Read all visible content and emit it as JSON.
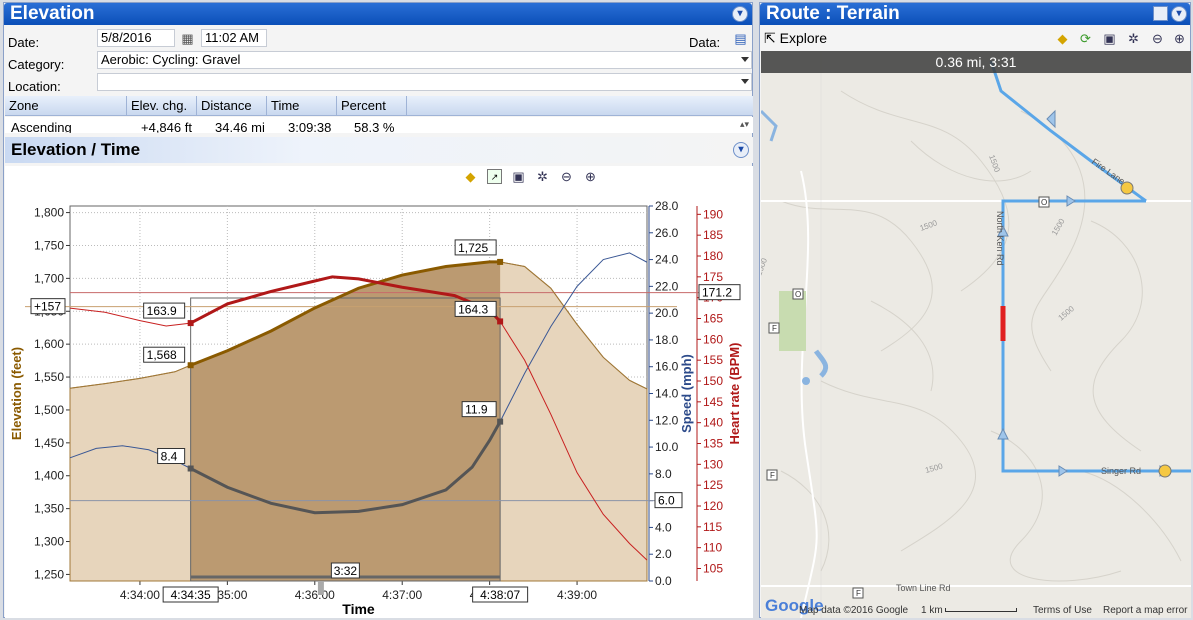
{
  "left_panel": {
    "title": "Elevation",
    "date_label": "Date:",
    "date_value": "5/8/2016",
    "time_value": "11:02 AM",
    "data_label": "Data:",
    "category_label": "Category:",
    "category_value": "Aerobic: Cycling: Gravel",
    "location_label": "Location:",
    "location_value": "",
    "grid": {
      "headers": [
        "Zone",
        "Elev. chg.",
        "Distance",
        "Time",
        "Percent"
      ],
      "row": [
        "Ascending",
        "+4,846 ft",
        "34.46 mi",
        "3:09:38",
        "58.3 %"
      ]
    }
  },
  "chart_panel": {
    "title": "Elevation / Time",
    "icons": [
      "diamond-icon",
      "chart-icon",
      "save-icon",
      "settings-icon",
      "zoom-out-icon",
      "zoom-in-icon"
    ]
  },
  "chart_data": {
    "type": "area",
    "xlabel": "Time",
    "x_ticks": [
      "4:34:00",
      "4:35:00",
      "4:36:00",
      "4:37:00",
      "4:38:00",
      "4:39:00"
    ],
    "elevation_axis": {
      "label": "Elevation (feet)",
      "ticks": [
        "1,800",
        "1,750",
        "1,700",
        "1,650",
        "1,600",
        "1,550",
        "1,500",
        "1,450",
        "1,400",
        "1,350",
        "1,300",
        "1,250"
      ],
      "range": [
        1240,
        1810
      ],
      "color": "#8a5a00"
    },
    "speed_axis": {
      "label": "Speed (mph)",
      "ticks": [
        "28.0",
        "26.0",
        "24.0",
        "22.0",
        "20.0",
        "18.0",
        "16.0",
        "14.0",
        "12.0",
        "10.0",
        "8.0",
        "6.0",
        "4.0",
        "2.0",
        "0.0"
      ],
      "range": [
        0,
        28
      ],
      "color": "#2c4a8a"
    },
    "hr_axis": {
      "label": "Heart rate (BPM)",
      "ticks": [
        "190",
        "185",
        "180",
        "175",
        "170",
        "165",
        "160",
        "155",
        "150",
        "145",
        "140",
        "135",
        "130",
        "125",
        "120",
        "115",
        "110",
        "105"
      ],
      "range": [
        102,
        192
      ],
      "color": "#b01818"
    },
    "x_range_min": [
      33.2,
      39.8
    ],
    "selection": {
      "start": "4:34:35",
      "end": "4:38:07",
      "duration": "3:32",
      "start_min": 34.58,
      "end_min": 38.12
    },
    "series": [
      {
        "name": "Elevation",
        "x_min": [
          33.2,
          33.6,
          34.0,
          34.4,
          34.58,
          35.0,
          35.5,
          36.0,
          36.5,
          37.0,
          37.5,
          38.0,
          38.12,
          38.4,
          38.7,
          39.0,
          39.3,
          39.6,
          39.8
        ],
        "values": [
          1533,
          1540,
          1548,
          1558,
          1568,
          1590,
          1620,
          1655,
          1685,
          1705,
          1718,
          1725,
          1725,
          1718,
          1685,
          1630,
          1580,
          1545,
          1532
        ]
      },
      {
        "name": "Speed",
        "x_min": [
          33.2,
          33.5,
          33.8,
          34.1,
          34.4,
          34.58,
          35.0,
          35.5,
          36.0,
          36.5,
          37.0,
          37.5,
          37.8,
          38.0,
          38.12,
          38.4,
          38.7,
          39.0,
          39.3,
          39.6,
          39.8
        ],
        "values": [
          9.2,
          9.9,
          10.1,
          9.8,
          9.0,
          8.4,
          7.0,
          5.8,
          5.1,
          5.2,
          5.7,
          6.8,
          8.5,
          10.5,
          11.9,
          15.5,
          19.0,
          22.0,
          24.0,
          24.5,
          23.8
        ]
      },
      {
        "name": "Heart rate",
        "x_min": [
          33.2,
          33.6,
          34.0,
          34.3,
          34.58,
          35.0,
          35.5,
          36.0,
          36.2,
          36.5,
          37.0,
          37.3,
          37.6,
          38.0,
          38.12,
          38.4,
          38.7,
          39.0,
          39.3,
          39.6,
          39.8
        ],
        "values": [
          167.5,
          166.5,
          164.5,
          163.2,
          163.9,
          168.5,
          171.5,
          174.0,
          175.0,
          174.5,
          172.5,
          171.5,
          170.5,
          167.0,
          164.3,
          155.0,
          142.0,
          128.0,
          118.0,
          111.0,
          107.0
        ]
      }
    ],
    "annotations": [
      {
        "axis": "elevation",
        "x_min": 34.58,
        "value": 1568,
        "label": "1,568"
      },
      {
        "axis": "elevation",
        "x_min": 38.12,
        "value": 1725,
        "label": "1,725"
      },
      {
        "axis": "hr",
        "x_min": 34.58,
        "value": 163.9,
        "label": "163.9"
      },
      {
        "axis": "hr",
        "x_min": 38.12,
        "value": 164.3,
        "label": "164.3"
      },
      {
        "axis": "speed",
        "x_min": 34.58,
        "value": 8.4,
        "label": "8.4"
      },
      {
        "axis": "speed",
        "x_min": 38.12,
        "value": 11.9,
        "label": "11.9"
      }
    ],
    "avg_lines": [
      {
        "axis": "hr",
        "value": 171.2,
        "label": "171.2"
      },
      {
        "axis": "speed",
        "value": 6.0,
        "label": "6.0"
      },
      {
        "axis": "elevation",
        "value": 1657,
        "label": "+157"
      }
    ],
    "grid": true
  },
  "right_panel": {
    "title": "Route : Terrain",
    "explore_label": "Explore",
    "map_info": "0.36 mi, 3:31",
    "road_labels": [
      "Fire Lane",
      "North Ken Rd",
      "Singer Rd",
      "Town Line Rd"
    ],
    "marker_labels": [
      "O",
      "O",
      "F",
      "F",
      "F"
    ],
    "contour_labels": [
      "1500",
      "1500",
      "1500",
      "1500",
      "1500",
      "1500"
    ],
    "google_logo": "Google",
    "footer_data": "Map data ©2016 Google",
    "footer_scale": "1 km",
    "footer_terms": "Terms of Use",
    "footer_report": "Report a map error"
  }
}
